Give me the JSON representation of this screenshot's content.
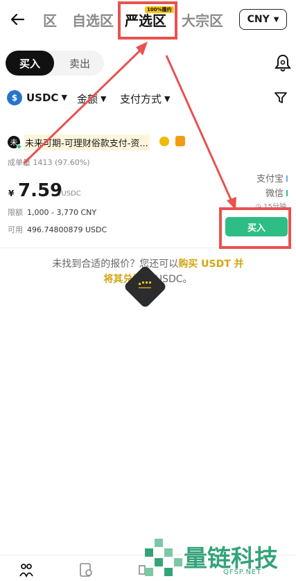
{
  "nav": {
    "tab_partial": "区",
    "tabs": [
      "自选区",
      "严选区",
      "大宗区"
    ],
    "active_badge": "100%履约",
    "currency": "CNY"
  },
  "trade": {
    "buy_label": "买入",
    "sell_label": "卖出"
  },
  "filters": {
    "coin": "USDC",
    "amount": "金额",
    "payment": "支付方式"
  },
  "offer": {
    "avatar_char": "未",
    "merchant": "未来可期-可理财俗款支付-资...",
    "stats_label": "成单量",
    "stats_value": "1413 (97.60%)",
    "currency_symbol": "¥",
    "price": "7.59",
    "price_unit": "/USDC",
    "limit_label": "限额",
    "limit_value": "1,000 - 3,770 CNY",
    "avail_label": "可用",
    "avail_value": "496.74800879 USDC",
    "payments": [
      "支付宝",
      "微信"
    ],
    "time": "◷ 15分钟",
    "buy_button": "买入"
  },
  "notfound": {
    "text1": "未找到合适的报价？您还可以",
    "link": "购买 USDT 并",
    "link2": "将其兑换",
    "text2": "为 USDC。"
  },
  "watermark": {
    "text": "量链科技",
    "sub": "QFSP.NET"
  },
  "colors": {
    "accent_green": "#2ebd85",
    "annotation_red": "#e8524f",
    "link_gold": "#d4a514"
  }
}
